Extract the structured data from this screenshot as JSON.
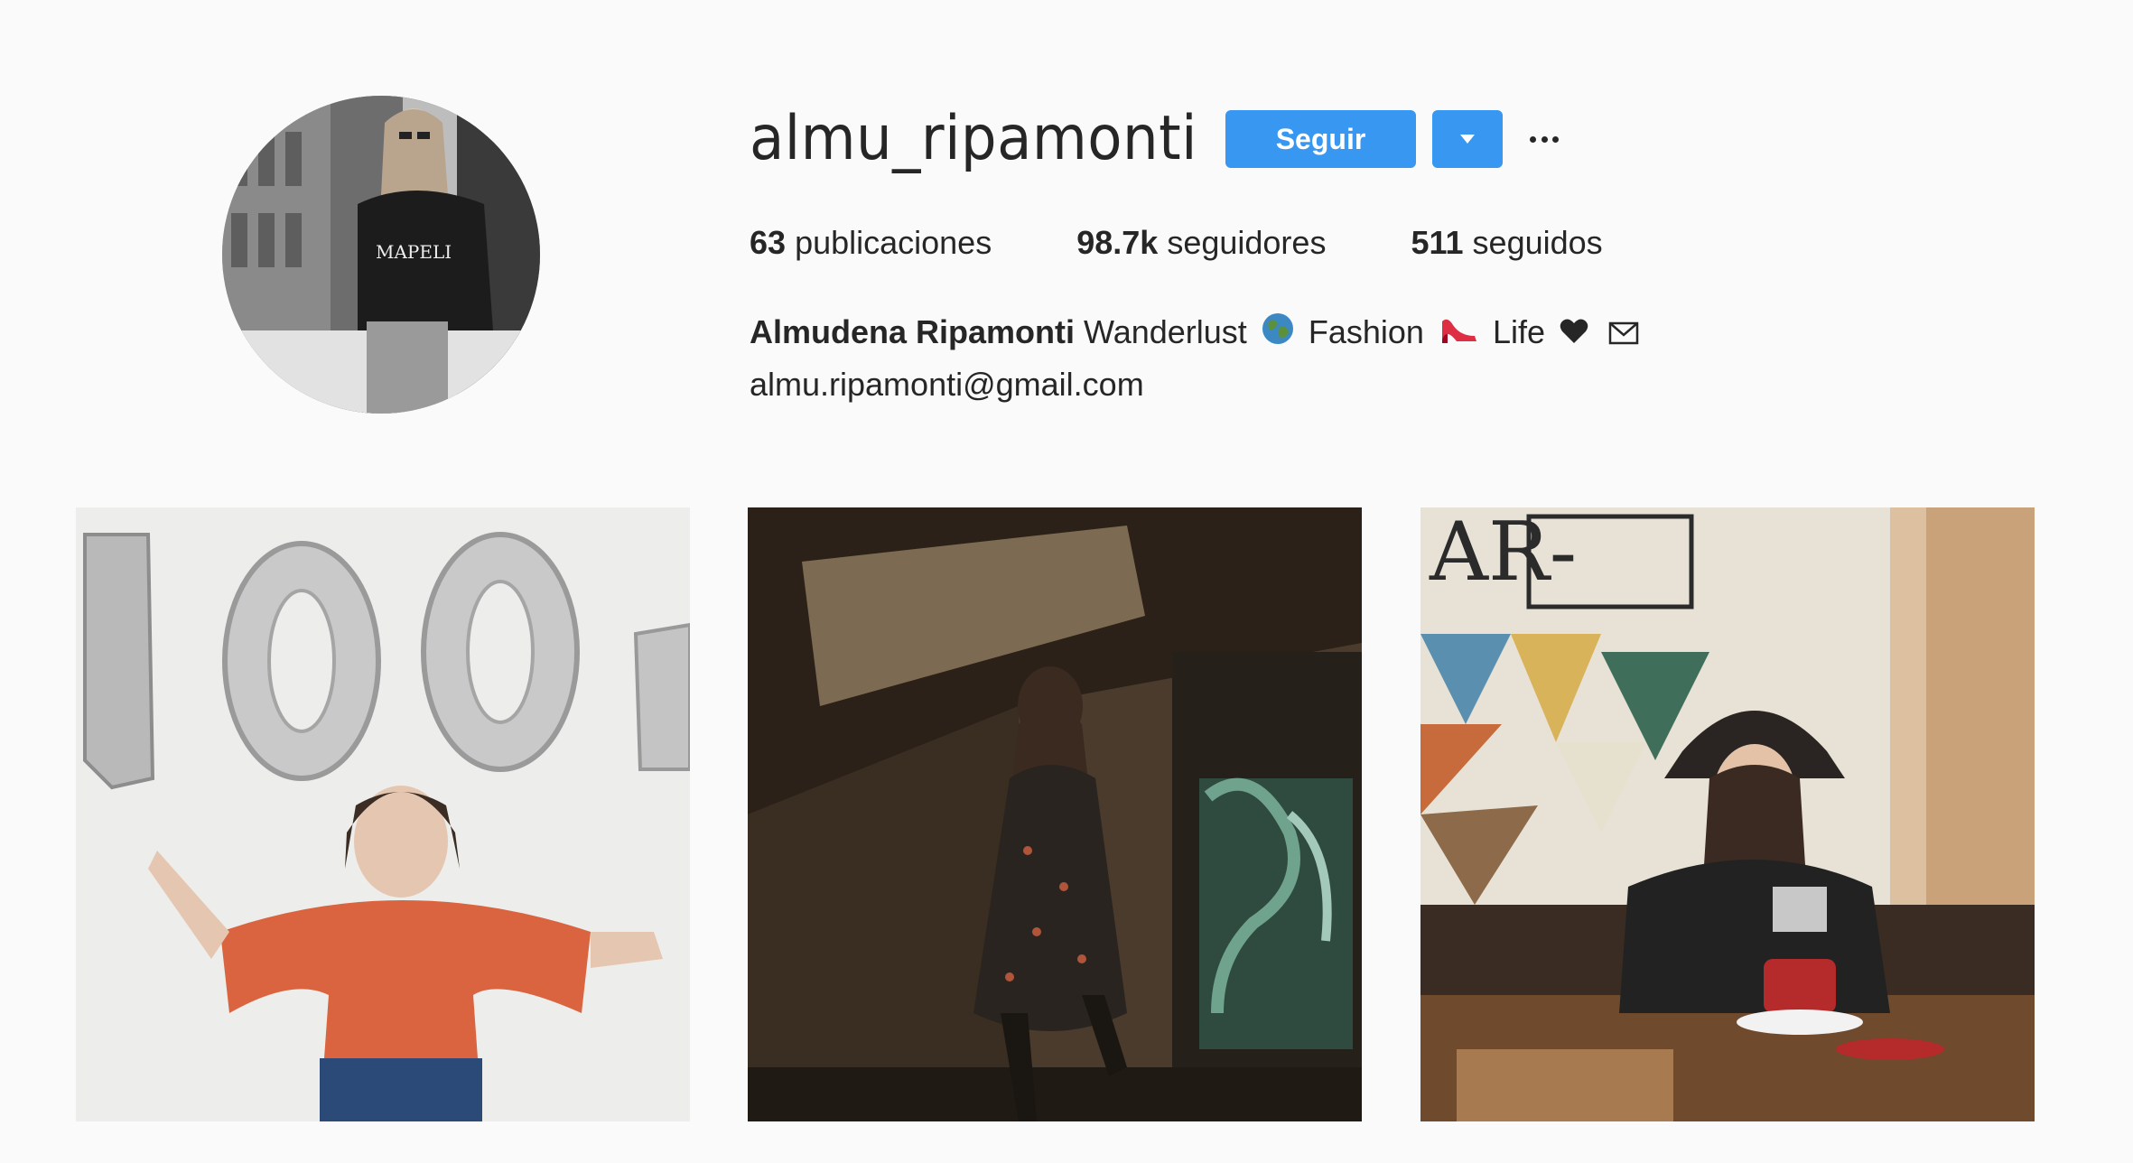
{
  "profile": {
    "username": "almu_ripamonti",
    "follow_label": "Seguir",
    "stats": {
      "posts_count": "63",
      "posts_label": "publicaciones",
      "followers_count": "98.7k",
      "followers_label": "seguidores",
      "following_count": "511",
      "following_label": "seguidos"
    },
    "bio": {
      "full_name": "Almudena Ripamonti",
      "word_1": "Wanderlust",
      "word_2": "Fashion",
      "word_3": "Life",
      "email": "almu.ripamonti@gmail.com",
      "emoji_icons": [
        "globe-icon",
        "high-heel-icon",
        "heart-icon",
        "envelope-icon"
      ]
    },
    "avatar_icon": "profile-photo",
    "more_icon": "more-options-icon",
    "dropdown_icon": "chevron-down-icon"
  },
  "posts": [
    {
      "icon": "photo-balloons-100"
    },
    {
      "icon": "photo-street-walk"
    },
    {
      "icon": "photo-cafe-tea"
    }
  ],
  "colors": {
    "accent": "#3897f0",
    "background": "#fafafa",
    "text": "#262626"
  }
}
